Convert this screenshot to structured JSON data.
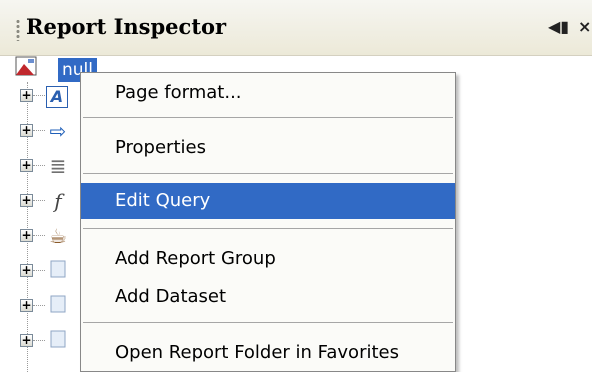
{
  "panel": {
    "title": "Report Inspector",
    "minimize_glyph": "◀▮",
    "close_glyph": "×"
  },
  "tree": {
    "root_label": "null",
    "nodes": [
      {
        "icon": "styles-icon",
        "glyph": "A"
      },
      {
        "icon": "parameters-icon",
        "glyph": "⇨"
      },
      {
        "icon": "fields-icon",
        "glyph": "≣"
      },
      {
        "icon": "variables-icon",
        "glyph": "f"
      },
      {
        "icon": "scriptlets-icon",
        "glyph": "☕"
      },
      {
        "icon": "band-icon",
        "glyph": ""
      },
      {
        "icon": "band-icon",
        "glyph": ""
      },
      {
        "icon": "band-icon",
        "glyph": ""
      }
    ]
  },
  "context_menu": {
    "items": [
      {
        "label": "Page format..."
      },
      {
        "label": "Properties"
      },
      {
        "label": "Edit Query",
        "highlighted": true
      },
      {
        "label": "Add Report Group"
      },
      {
        "label": "Add Dataset"
      },
      {
        "label": "Open Report Folder in Favorites"
      }
    ]
  },
  "colors": {
    "highlight": "#316ac5",
    "header_bg": "#ece9d8",
    "menu_bg": "#fbfbf8"
  }
}
